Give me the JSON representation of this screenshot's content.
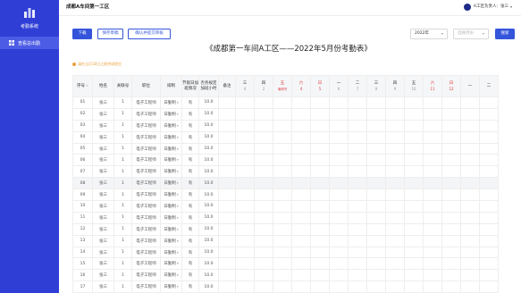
{
  "sidebar": {
    "logo_text": "考勤系统",
    "items": [
      {
        "label": "查看总出勤",
        "icon": "grid-icon"
      }
    ]
  },
  "header": {
    "title": "成都A车间第一工区",
    "user": "A工区负责人：张三"
  },
  "toolbar": {
    "download_label": "下载",
    "save_label": "保存草稿",
    "confirm_label": "确认并提交审核",
    "year_value": "2022年",
    "month_placeholder": "选择月份",
    "search_label": "搜索"
  },
  "sheet_title": "《成都第一车间A工区——2022年5月份考勤表》",
  "notice": "请在当月18日之前完成提交",
  "table": {
    "headers": {
      "no": "序号",
      "name": "姓名",
      "emp_no": "关联号",
      "position": "职位",
      "shift": "排制",
      "ot": "节假日加班情况",
      "std_hours": "否务规定加班小时",
      "remark": "备注"
    },
    "days": [
      {
        "wk": "三",
        "dt": "4",
        "red": false,
        "note": ""
      },
      {
        "wk": "四",
        "dt": "2",
        "red": false,
        "note": ""
      },
      {
        "wk": "五",
        "dt": "3",
        "red": true,
        "note": "清明节"
      },
      {
        "wk": "六",
        "dt": "4",
        "red": true,
        "note": ""
      },
      {
        "wk": "日",
        "dt": "5",
        "red": true,
        "note": ""
      },
      {
        "wk": "一",
        "dt": "6",
        "red": false,
        "note": ""
      },
      {
        "wk": "二",
        "dt": "7",
        "red": false,
        "note": ""
      },
      {
        "wk": "三",
        "dt": "8",
        "red": false,
        "note": ""
      },
      {
        "wk": "四",
        "dt": "9",
        "red": false,
        "note": ""
      },
      {
        "wk": "五",
        "dt": "10",
        "red": false,
        "note": ""
      },
      {
        "wk": "六",
        "dt": "11",
        "red": true,
        "note": ""
      },
      {
        "wk": "日",
        "dt": "12",
        "red": true,
        "note": ""
      },
      {
        "wk": "一",
        "dt": "",
        "red": false,
        "note": ""
      },
      {
        "wk": "二",
        "dt": "",
        "red": false,
        "note": ""
      }
    ],
    "rows": [
      {
        "no": "01",
        "name": "张三",
        "emp_no": "1",
        "position": "电子工程师",
        "shift": "日勤制",
        "ot": "有",
        "std_hours": "10.0"
      },
      {
        "no": "02",
        "name": "张三",
        "emp_no": "1",
        "position": "电子工程师",
        "shift": "日勤制",
        "ot": "有",
        "std_hours": "10.0"
      },
      {
        "no": "03",
        "name": "张三",
        "emp_no": "1",
        "position": "电子工程师",
        "shift": "日勤制",
        "ot": "有",
        "std_hours": "10.0"
      },
      {
        "no": "04",
        "name": "张三",
        "emp_no": "1",
        "position": "电子工程师",
        "shift": "日勤制",
        "ot": "有",
        "std_hours": "10.0"
      },
      {
        "no": "05",
        "name": "张三",
        "emp_no": "1",
        "position": "电子工程师",
        "shift": "日勤制",
        "ot": "有",
        "std_hours": "10.0"
      },
      {
        "no": "06",
        "name": "张三",
        "emp_no": "1",
        "position": "电子工程师",
        "shift": "日勤制",
        "ot": "有",
        "std_hours": "10.0"
      },
      {
        "no": "07",
        "name": "张三",
        "emp_no": "1",
        "position": "电子工程师",
        "shift": "日勤制",
        "ot": "有",
        "std_hours": "10.0"
      },
      {
        "no": "08",
        "name": "张三",
        "emp_no": "1",
        "position": "电子工程师",
        "shift": "日勤制",
        "ot": "有",
        "std_hours": "10.0"
      },
      {
        "no": "09",
        "name": "张三",
        "emp_no": "1",
        "position": "电子工程师",
        "shift": "日勤制",
        "ot": "有",
        "std_hours": "10.0"
      },
      {
        "no": "10",
        "name": "张三",
        "emp_no": "1",
        "position": "电子工程师",
        "shift": "日勤制",
        "ot": "有",
        "std_hours": "10.0"
      },
      {
        "no": "11",
        "name": "张三",
        "emp_no": "1",
        "position": "电子工程师",
        "shift": "日勤制",
        "ot": "有",
        "std_hours": "10.0"
      },
      {
        "no": "12",
        "name": "张三",
        "emp_no": "1",
        "position": "电子工程师",
        "shift": "日勤制",
        "ot": "有",
        "std_hours": "10.0"
      },
      {
        "no": "13",
        "name": "张三",
        "emp_no": "1",
        "position": "电子工程师",
        "shift": "日勤制",
        "ot": "有",
        "std_hours": "10.0"
      },
      {
        "no": "14",
        "name": "张三",
        "emp_no": "1",
        "position": "电子工程师",
        "shift": "日勤制",
        "ot": "有",
        "std_hours": "10.0"
      },
      {
        "no": "15",
        "name": "张三",
        "emp_no": "1",
        "position": "电子工程师",
        "shift": "日勤制",
        "ot": "有",
        "std_hours": "10.0"
      },
      {
        "no": "16",
        "name": "张三",
        "emp_no": "1",
        "position": "电子工程师",
        "shift": "日勤制",
        "ot": "有",
        "std_hours": "10.0"
      },
      {
        "no": "17",
        "name": "张三",
        "emp_no": "1",
        "position": "电子工程师",
        "shift": "日勤制",
        "ot": "有",
        "std_hours": "10.0"
      }
    ],
    "highlighted_row": 7
  },
  "colors": {
    "sidebar": "#2f3fd6",
    "primary": "#3455db",
    "holiday": "#e03c3c",
    "warning": "#e6a23c"
  }
}
